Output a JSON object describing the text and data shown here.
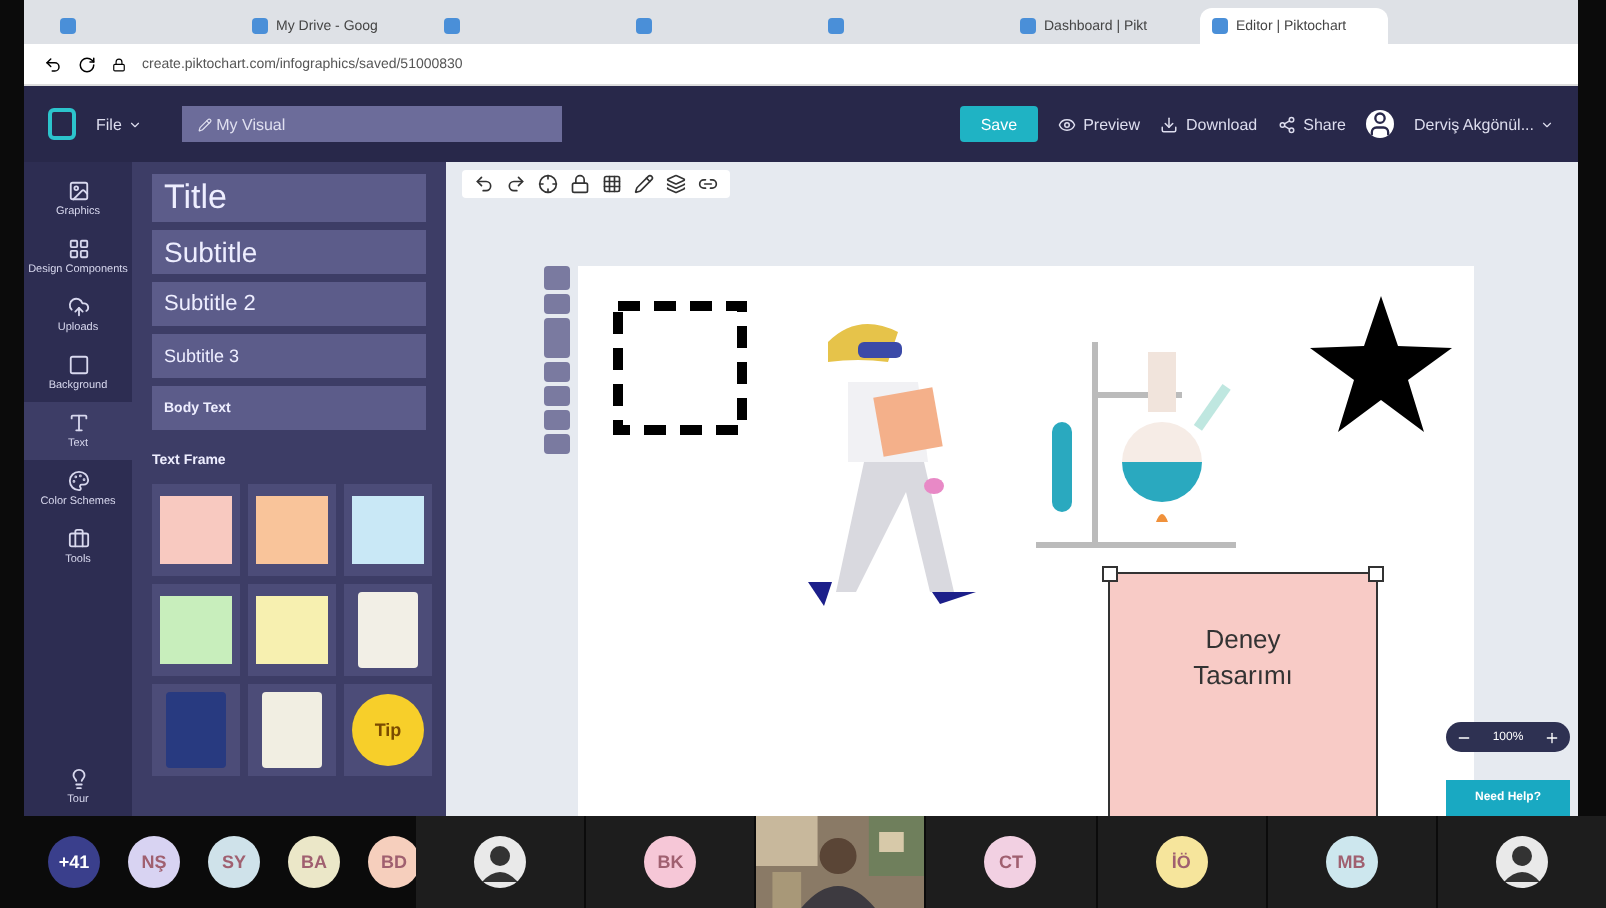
{
  "browser": {
    "tabs": [
      {
        "selected": false
      },
      {
        "title": "My Drive - Goog",
        "selected": false
      },
      {
        "selected": false
      },
      {
        "selected": false
      },
      {
        "selected": false
      },
      {
        "title": "Dashboard | Pikt",
        "selected": false
      },
      {
        "title": "Editor | Piktochart",
        "selected": true
      }
    ],
    "url": "create.piktochart.com/infographics/saved/51000830"
  },
  "header": {
    "file_menu": "File",
    "document_name": "My Visual",
    "save": "Save",
    "preview": "Preview",
    "download": "Download",
    "share": "Share",
    "user": "Derviş Akgönül..."
  },
  "sidebar": {
    "items": [
      {
        "label": "Graphics",
        "kind": "graphics",
        "selected": false
      },
      {
        "label": "Design Components",
        "kind": "components",
        "selected": false
      },
      {
        "label": "Uploads",
        "kind": "uploads",
        "selected": false
      },
      {
        "label": "Background",
        "kind": "background",
        "selected": false
      },
      {
        "label": "Text",
        "kind": "text",
        "selected": true
      },
      {
        "label": "Color Schemes",
        "kind": "colors",
        "selected": false
      },
      {
        "label": "Tools",
        "kind": "tools",
        "selected": false
      }
    ],
    "tour": "Tour"
  },
  "text_panel": {
    "styles": [
      "Title",
      "Subtitle",
      "Subtitle 2",
      "Subtitle 3",
      "Body Text"
    ],
    "section": "Text Frame",
    "frames": [
      {
        "kind": "note",
        "color": "#f8c9c0"
      },
      {
        "kind": "note",
        "color": "#f9c49a"
      },
      {
        "kind": "note",
        "color": "#c9e8f6"
      },
      {
        "kind": "note",
        "color": "#c8eebc"
      },
      {
        "kind": "note",
        "color": "#f7f0b0"
      },
      {
        "kind": "paper",
        "color": "#f2efe6"
      },
      {
        "kind": "paper",
        "color": "#283a80"
      },
      {
        "kind": "paper",
        "color": "#f1eee2"
      },
      {
        "kind": "circle",
        "color": "#f7cf2a",
        "label": "Tip"
      }
    ]
  },
  "canvas": {
    "text_frame": {
      "lines": [
        "Deney",
        "Tasarımı"
      ],
      "selected": true
    }
  },
  "zoom": "100%",
  "help": "Need Help?",
  "participants": [
    {
      "kind": "more",
      "label": "+41",
      "color": "#3a3f8c"
    },
    {
      "kind": "initials",
      "label": "NŞ",
      "color": "#d8d3f2"
    },
    {
      "kind": "initials",
      "label": "SY",
      "color": "#cfe2ea"
    },
    {
      "kind": "initials",
      "label": "BA",
      "color": "#ebe7c8"
    },
    {
      "kind": "initials",
      "label": "BD",
      "color": "#f6cfbd"
    },
    {
      "kind": "tile_avatar"
    },
    {
      "kind": "tile",
      "label": "BK",
      "color": "#f6c7d7"
    },
    {
      "kind": "video"
    },
    {
      "kind": "tile",
      "label": "CT",
      "color": "#f2d0e2"
    },
    {
      "kind": "tile",
      "label": "İÖ",
      "color": "#f6e59c"
    },
    {
      "kind": "tile",
      "label": "MB",
      "color": "#cde7ee"
    },
    {
      "kind": "tile_avatar"
    }
  ]
}
